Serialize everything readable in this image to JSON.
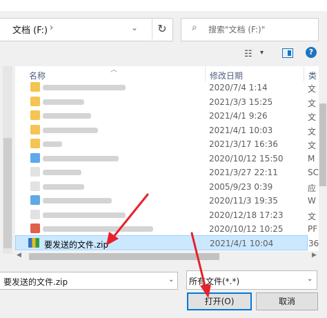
{
  "address_bar": {
    "location": "文档 (F:)",
    "separator": "›",
    "dropdown_glyph": "⌄",
    "refresh_glyph": "↻"
  },
  "search": {
    "placeholder": "搜索\"文档 (F:)\"",
    "icon": "search-icon"
  },
  "toolbar": {
    "view_icon_glyph": "☷",
    "view_dropdown_glyph": "▾",
    "help_glyph": "?"
  },
  "columns": {
    "name": "名称",
    "date": "修改日期",
    "type": "类"
  },
  "rows": [
    {
      "date": "2020/7/4 1:14",
      "type": "文",
      "icon_color": "#f6c453",
      "selected": false
    },
    {
      "date": "2021/3/3 15:25",
      "type": "文",
      "icon_color": "#f6c453",
      "selected": false
    },
    {
      "date": "2021/4/1 9:26",
      "type": "文",
      "icon_color": "#f6c453",
      "selected": false
    },
    {
      "date": "2021/4/1 10:03",
      "type": "文",
      "icon_color": "#f6c453",
      "selected": false
    },
    {
      "date": "2021/3/17 16:36",
      "type": "文",
      "icon_color": "#f6c453",
      "selected": false
    },
    {
      "date": "2020/10/12 15:50",
      "type": "M",
      "icon_color": "#5fa9e8",
      "selected": false
    },
    {
      "date": "2021/3/27 22:11",
      "type": "SC",
      "icon_color": "#e2e2e2",
      "selected": false
    },
    {
      "date": "2005/9/23 0:39",
      "type": "应",
      "icon_color": "#e2e2e2",
      "selected": false
    },
    {
      "date": "2020/11/3 19:35",
      "type": "W",
      "icon_color": "#5fa9e8",
      "selected": false
    },
    {
      "date": "2020/12/18 17:23",
      "type": "文",
      "icon_color": "#e2e2e2",
      "selected": false
    },
    {
      "date": "2020/10/12 10:25",
      "type": "PF",
      "icon_color": "#e0604a",
      "selected": false
    },
    {
      "name": "要发送的文件.zip",
      "date": "2021/4/1 10:04",
      "type": "36",
      "icon": "zip-archive-icon",
      "selected": true
    }
  ],
  "filename_field": {
    "value": "要发送的文件.zip"
  },
  "file_type_filter": {
    "value": "所有文件(*.*)"
  },
  "buttons": {
    "open": "打开(O)",
    "cancel": "取消"
  },
  "colors": {
    "selection_bg": "#cce8ff",
    "selection_border": "#99d1ff",
    "accent": "#0078d7",
    "annotation_arrow": "#e8202a"
  }
}
